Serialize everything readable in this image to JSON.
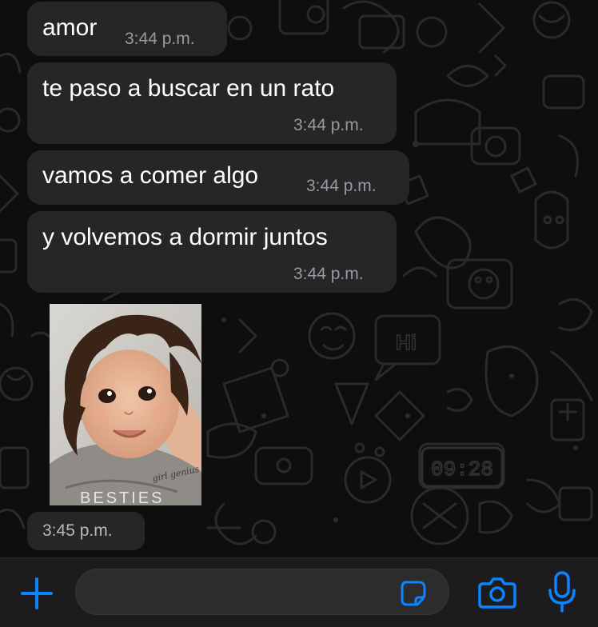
{
  "wallpaper": {
    "clock_text": "09:28",
    "hi_text": "Hi"
  },
  "messages": [
    {
      "text": "amor",
      "time": "3:44 p.m."
    },
    {
      "text": "te paso a buscar en un rato",
      "time": "3:44 p.m."
    },
    {
      "text": "vamos a comer algo",
      "time": "3:44 p.m."
    },
    {
      "text": "y volvemos a dormir juntos",
      "time": "3:44 p.m."
    }
  ],
  "image_message": {
    "shirt_text": "girl genius",
    "shirt_text_2": "BESTIES",
    "time": "3:45 p.m."
  },
  "input_bar": {
    "placeholder": "",
    "accent_color": "#0a84ff"
  },
  "icons": {
    "add": "plus-icon",
    "sticker": "sticker-icon",
    "camera": "camera-icon",
    "mic": "microphone-icon"
  }
}
